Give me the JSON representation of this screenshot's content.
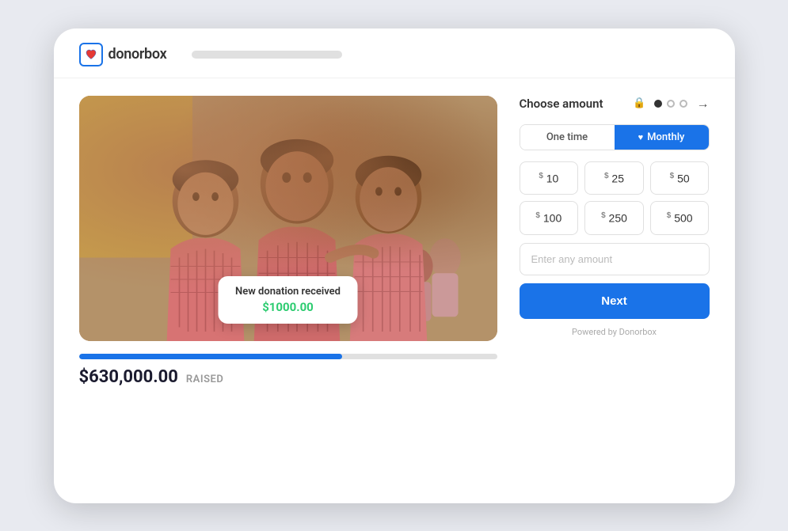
{
  "branding": {
    "logo_text": "donorbox",
    "logo_icon_symbol": "♥"
  },
  "campaign": {
    "image_alt": "Three school children in pink shirts",
    "notification": {
      "title": "New donation received",
      "amount": "$1000.00"
    },
    "progress": {
      "raised_amount": "$630,000.00",
      "raised_label": "RAISED",
      "percentage": 63
    }
  },
  "donation_widget": {
    "title": "Choose amount",
    "frequency_tabs": [
      {
        "label": "One time",
        "active": false
      },
      {
        "label": "Monthly",
        "active": true
      }
    ],
    "amounts": [
      {
        "currency": "$",
        "value": "10"
      },
      {
        "currency": "$",
        "value": "25"
      },
      {
        "currency": "$",
        "value": "50"
      },
      {
        "currency": "$",
        "value": "100"
      },
      {
        "currency": "$",
        "value": "250"
      },
      {
        "currency": "$",
        "value": "500"
      }
    ],
    "custom_input_placeholder": "Enter any amount",
    "next_button_label": "Next",
    "powered_by": "Powered by Donorbox"
  },
  "colors": {
    "primary": "#1a73e8",
    "success": "#2ecc71",
    "text_dark": "#1a1a2e",
    "text_muted": "#999"
  }
}
